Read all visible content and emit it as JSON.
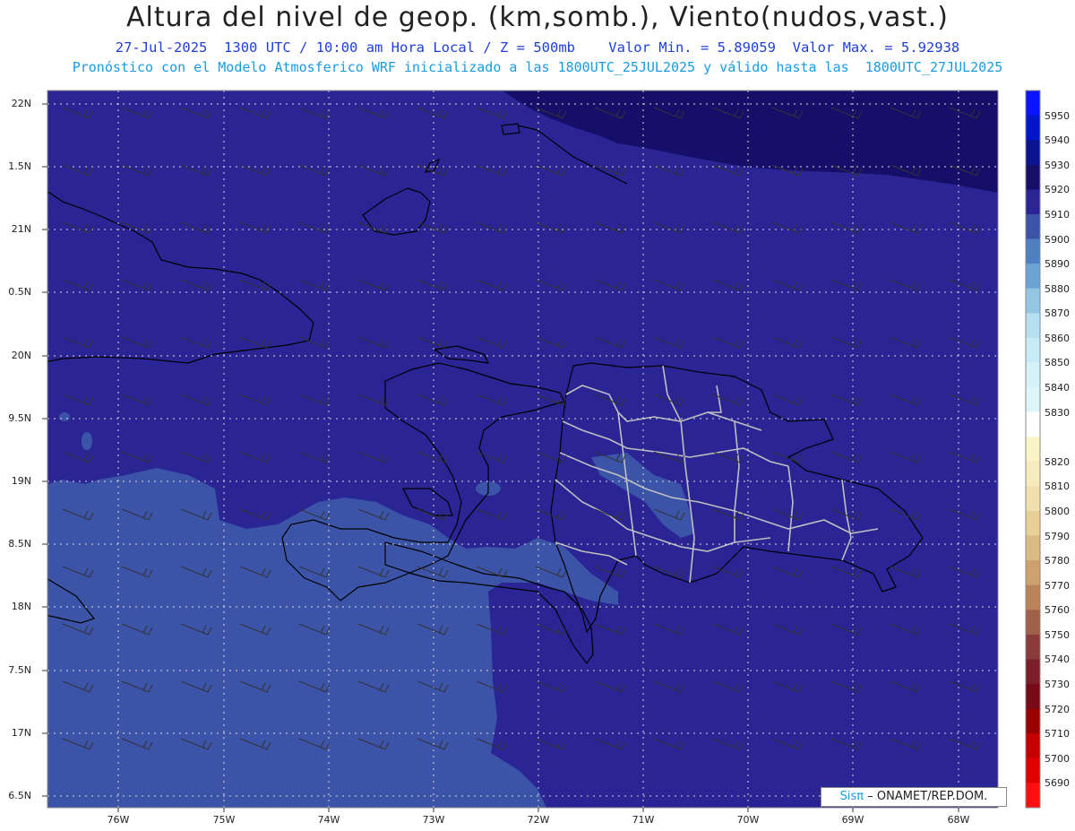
{
  "header": {
    "title": "Altura del nivel de geop. (km,somb.), Viento(nudos,vast.)",
    "subtitle": "27-Jul-2025  1300 UTC / 10:00 am Hora Local / Z = 500mb    Valor Min. = 5.89059  Valor Max. = 5.92938",
    "subtitle2": "Pronóstico con el Modelo Atmosferico WRF inicializado a las 1800UTC_25JUL2025 y válido hasta las  1800UTC_27JUL2025"
  },
  "axes": {
    "lat_labels": [
      "22N",
      "1.5N",
      "21N",
      "0.5N",
      "20N",
      "9.5N",
      "19N",
      "8.5N",
      "18N",
      "7.5N",
      "17N",
      "6.5N"
    ],
    "lon_labels": [
      "76W",
      "75W",
      "74W",
      "73W",
      "72W",
      "71W",
      "70W",
      "69W",
      "68W"
    ]
  },
  "colorbar": {
    "labels": [
      "5950",
      "5940",
      "5930",
      "5920",
      "5910",
      "5900",
      "5890",
      "5880",
      "5870",
      "5860",
      "5850",
      "5840",
      "5830",
      "5820",
      "5810",
      "5800",
      "5790",
      "5780",
      "5770",
      "5760",
      "5750",
      "5740",
      "5730",
      "5720",
      "5710",
      "5700",
      "5690"
    ],
    "colors": [
      "#0a14ff",
      "#0016c8",
      "#0a1490",
      "#160f6a",
      "#2a2495",
      "#3b54a8",
      "#4e7fc0",
      "#6aa3d4",
      "#92c6e2",
      "#b6e0ef",
      "#c8ecf6",
      "#d4f2f8",
      "#ddf6f9",
      "#ffffff",
      "#fbf3c8",
      "#f6ebbd",
      "#f1e0ad",
      "#e8cf96",
      "#dbb982",
      "#cda06c",
      "#b9825a",
      "#a0604a",
      "#8a3a38",
      "#7a1e2a",
      "#780a18",
      "#9a0000",
      "#c40000",
      "#e00000",
      "#ff1010"
    ]
  },
  "legend": {
    "sis": "Sisπ",
    "credit": "– ONAMET/REP.DOM."
  }
}
